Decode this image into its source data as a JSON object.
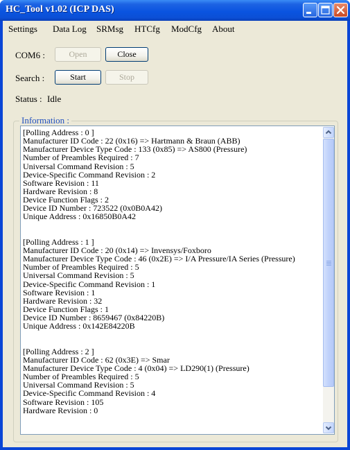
{
  "window": {
    "title": "HC_Tool v1.02  (ICP DAS)"
  },
  "menu": [
    "Settings",
    "Data Log",
    "SRMsg",
    "HTCfg",
    "ModCfg",
    "About"
  ],
  "com": {
    "label": "COM6 :",
    "open_label": "Open",
    "close_label": "Close"
  },
  "search": {
    "label": "Search :",
    "start_label": "Start",
    "stop_label": "Stop"
  },
  "status": {
    "label": "Status :",
    "value": "Idle"
  },
  "info": {
    "title": "Information :",
    "lines": [
      "[Polling Address : 0 ]",
      "Manufacturer ID Code : 22 (0x16) => Hartmann & Braun (ABB)",
      "Manufacturer Device Type Code : 133 (0x85) => AS800 (Pressure)",
      "Number of Preambles Required : 7",
      "Universal Command Revision : 5",
      "Device-Specific Command Revision : 2",
      "Software Revision : 11",
      "Hardware Revision : 8",
      "Device Function Flags : 2",
      "Device ID Number : 723522 (0x0B0A42)",
      "Unique Address : 0x16850B0A42",
      "",
      "",
      "[Polling Address : 1 ]",
      "Manufacturer ID Code : 20 (0x14) => Invensys/Foxboro",
      "Manufacturer Device Type Code : 46 (0x2E) => I/A Pressure/IA Series (Pressure)",
      "Number of Preambles Required : 5",
      "Universal Command Revision : 5",
      "Device-Specific Command Revision : 1",
      "Software Revision : 1",
      "Hardware Revision : 32",
      "Device Function Flags : 1",
      "Device ID Number : 8659467 (0x84220B)",
      "Unique Address : 0x142E84220B",
      "",
      "",
      "[Polling Address : 2 ]",
      "Manufacturer ID Code : 62 (0x3E) => Smar",
      "Manufacturer Device Type Code : 4 (0x04) => LD290(1) (Pressure)",
      "Number of Preambles Required : 5",
      "Universal Command Revision : 5",
      "Device-Specific Command Revision : 4",
      "Software Revision : 105",
      "Hardware Revision : 0"
    ]
  },
  "colors": {
    "titlebar": "#0a54e0",
    "face": "#ece9d8",
    "group_title": "#1f4fbf",
    "scrollbar": "#c0d2fb"
  },
  "icons": [
    "minimize-icon",
    "maximize-icon",
    "close-icon",
    "scroll-up-icon",
    "scroll-down-icon"
  ]
}
